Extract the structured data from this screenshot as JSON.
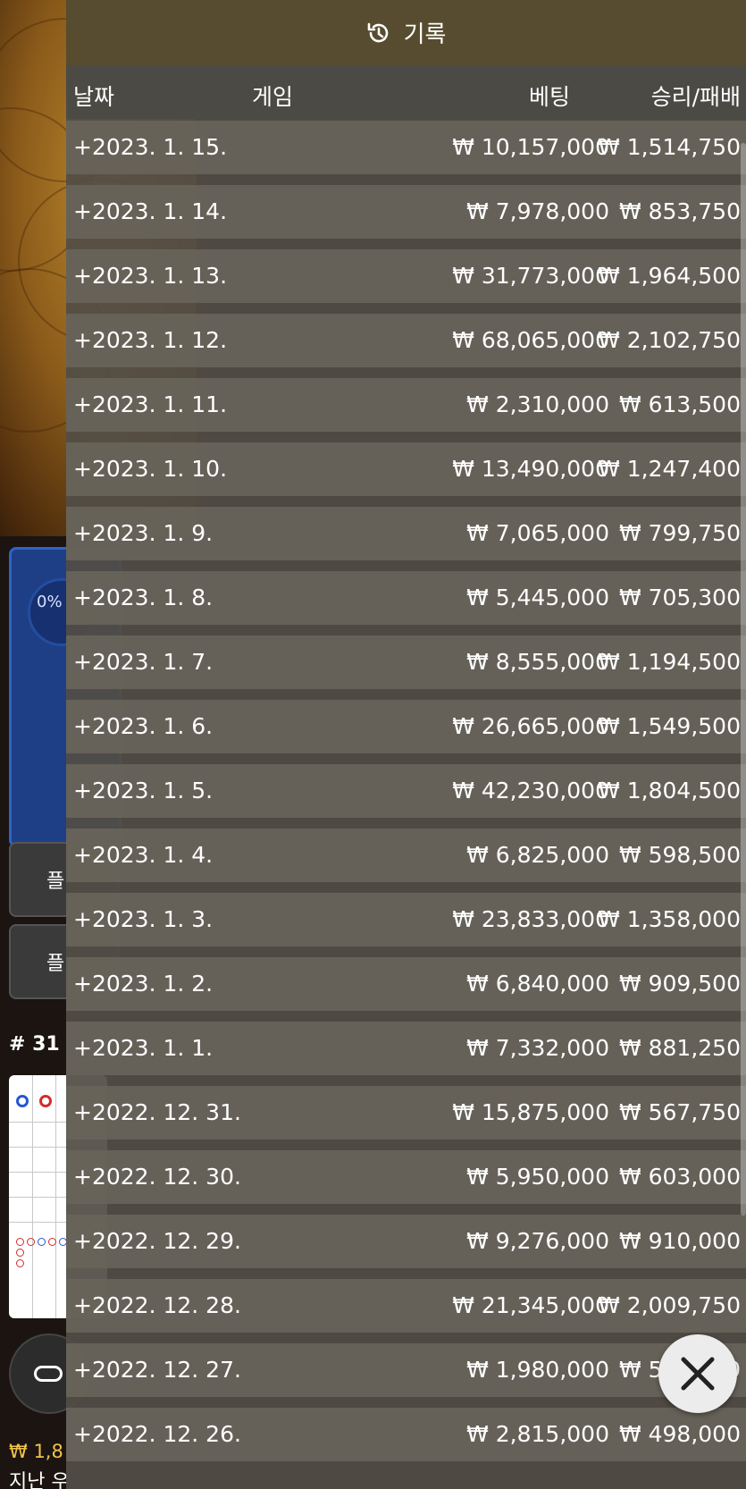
{
  "header": {
    "title": "기록",
    "icon": "history-icon"
  },
  "columns": {
    "date": "날짜",
    "game": "게임",
    "bet": "베팅",
    "win_loss": "승리/패배"
  },
  "rows": [
    {
      "date": "+2023. 1. 15.",
      "bet": "₩ 10,157,000",
      "win_loss": "₩ 1,514,750"
    },
    {
      "date": "+2023. 1. 14.",
      "bet": "₩ 7,978,000",
      "win_loss": "₩ 853,750"
    },
    {
      "date": "+2023. 1. 13.",
      "bet": "₩ 31,773,000",
      "win_loss": "₩ 1,964,500"
    },
    {
      "date": "+2023. 1. 12.",
      "bet": "₩ 68,065,000",
      "win_loss": "₩ 2,102,750"
    },
    {
      "date": "+2023. 1. 11.",
      "bet": "₩ 2,310,000",
      "win_loss": "₩ 613,500"
    },
    {
      "date": "+2023. 1. 10.",
      "bet": "₩ 13,490,000",
      "win_loss": "₩ 1,247,400"
    },
    {
      "date": "+2023. 1. 9.",
      "bet": "₩ 7,065,000",
      "win_loss": "₩ 799,750"
    },
    {
      "date": "+2023. 1. 8.",
      "bet": "₩ 5,445,000",
      "win_loss": "₩ 705,300"
    },
    {
      "date": "+2023. 1. 7.",
      "bet": "₩ 8,555,000",
      "win_loss": "₩ 1,194,500"
    },
    {
      "date": "+2023. 1. 6.",
      "bet": "₩ 26,665,000",
      "win_loss": "₩ 1,549,500"
    },
    {
      "date": "+2023. 1. 5.",
      "bet": "₩ 42,230,000",
      "win_loss": "₩ 1,804,500"
    },
    {
      "date": "+2023. 1. 4.",
      "bet": "₩ 6,825,000",
      "win_loss": "₩ 598,500"
    },
    {
      "date": "+2023. 1. 3.",
      "bet": "₩ 23,833,000",
      "win_loss": "₩ 1,358,000"
    },
    {
      "date": "+2023. 1. 2.",
      "bet": "₩ 6,840,000",
      "win_loss": "₩ 909,500"
    },
    {
      "date": "+2023. 1. 1.",
      "bet": "₩ 7,332,000",
      "win_loss": "₩ 881,250"
    },
    {
      "date": "+2022. 12. 31.",
      "bet": "₩ 15,875,000",
      "win_loss": "₩ 567,750"
    },
    {
      "date": "+2022. 12. 30.",
      "bet": "₩ 5,950,000",
      "win_loss": "₩ 603,000"
    },
    {
      "date": "+2022. 12. 29.",
      "bet": "₩ 9,276,000",
      "win_loss": "₩ 910,000"
    },
    {
      "date": "+2022. 12. 28.",
      "bet": "₩ 21,345,000",
      "win_loss": "₩ 2,009,750"
    },
    {
      "date": "+2022. 12. 27.",
      "bet": "₩ 1,980,000",
      "win_loss": "₩ 551,700"
    },
    {
      "date": "+2022. 12. 26.",
      "bet": "₩ 2,815,000",
      "win_loss": "₩ 498,000"
    }
  ],
  "background": {
    "progress_percent": "0%",
    "round_label": "# 31",
    "balance": "₩ 1,8",
    "balance_label": "지난 우"
  },
  "close_button": {
    "icon": "close-icon"
  }
}
